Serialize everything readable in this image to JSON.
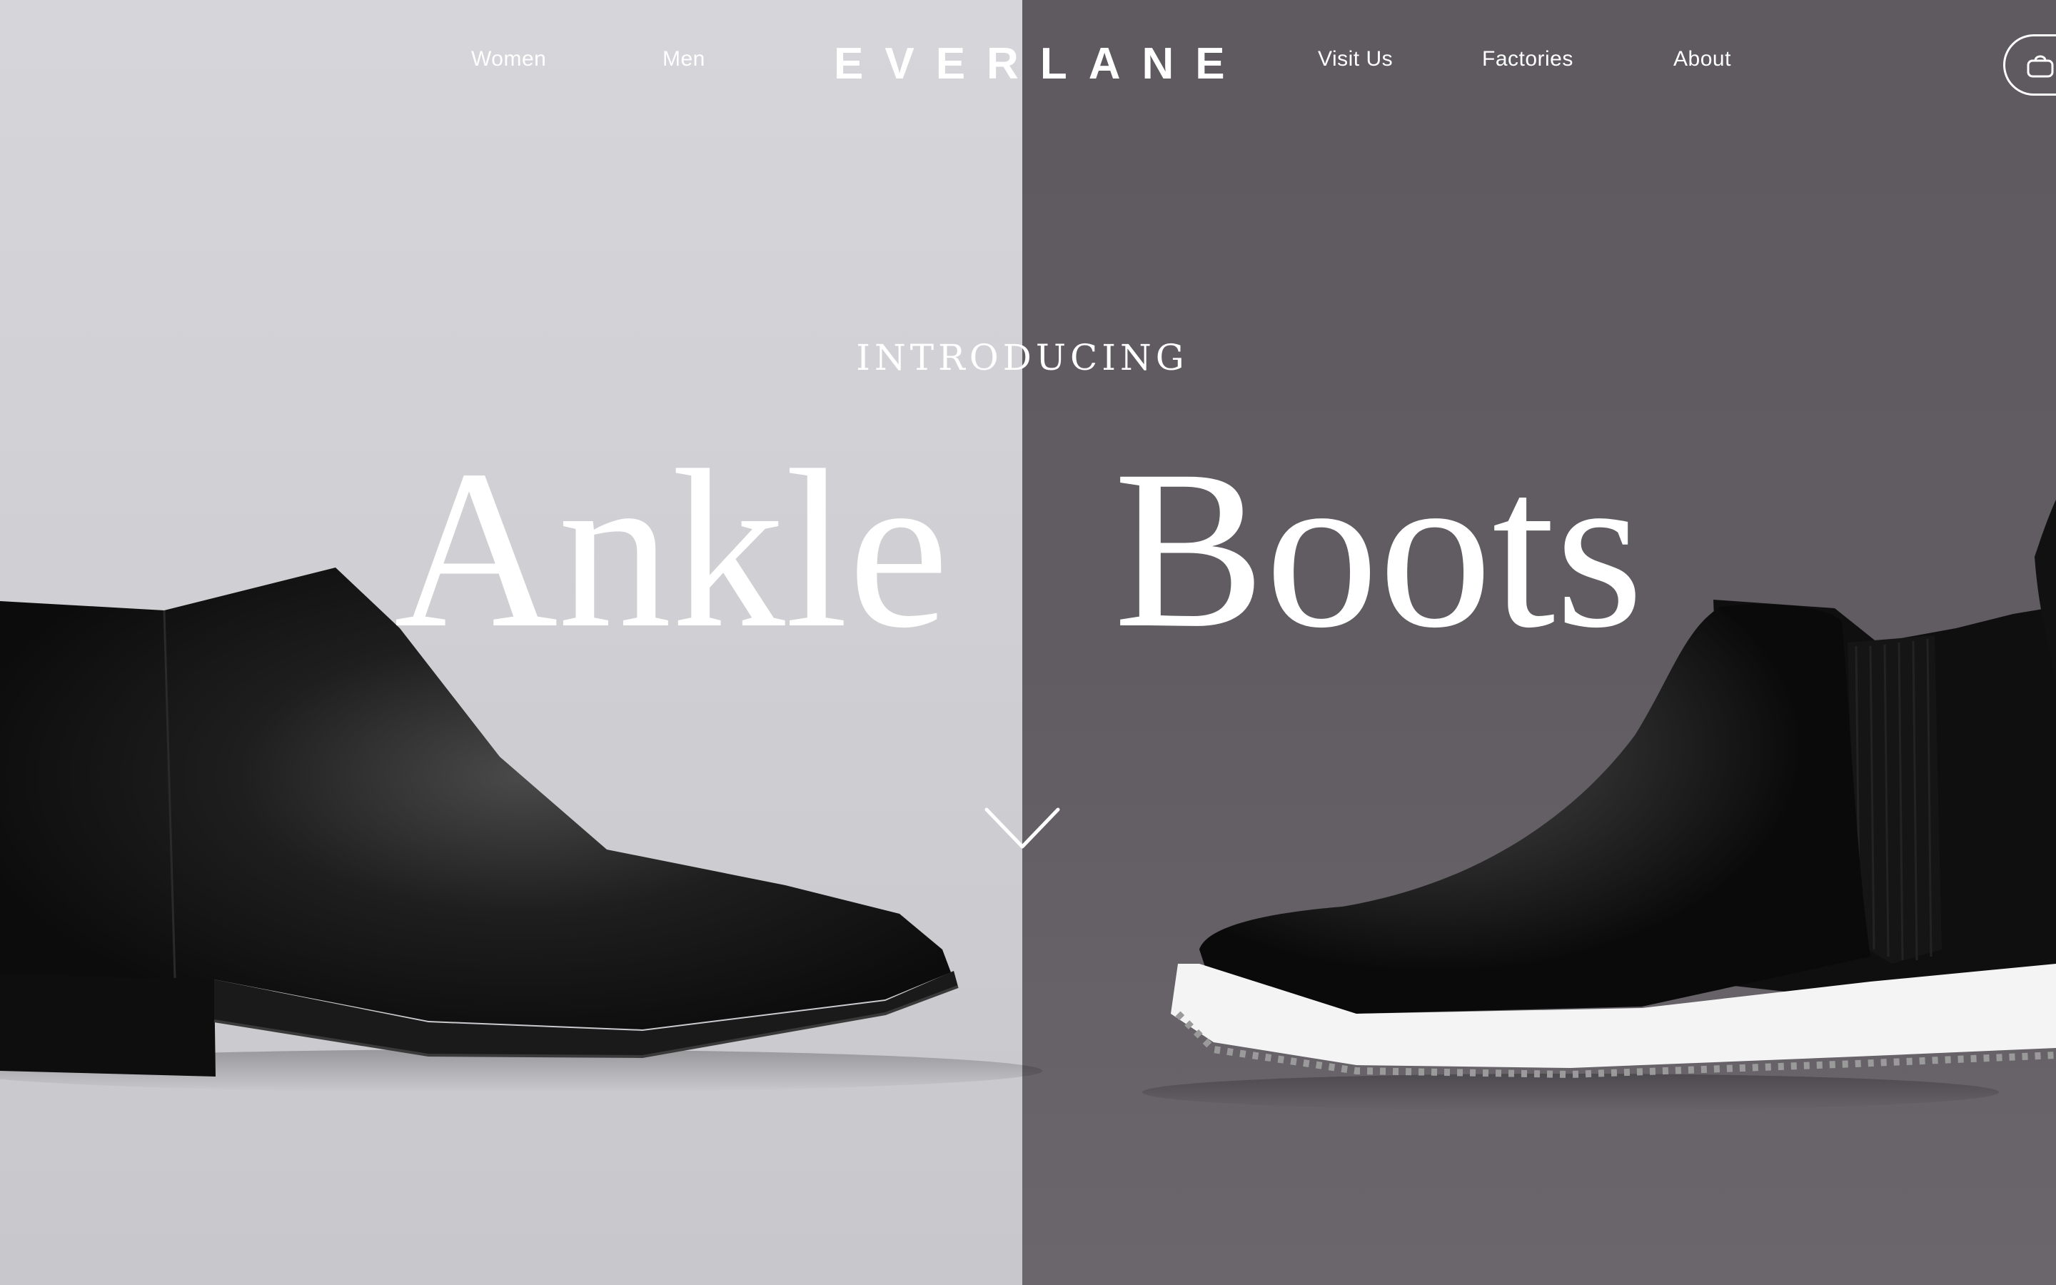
{
  "nav": {
    "left_links": [
      "Women",
      "Men"
    ],
    "logo": "EVERLANE",
    "right_links": [
      "Visit Us",
      "Factories",
      "About"
    ],
    "cart_icon": "cart-bag-icon"
  },
  "hero": {
    "kicker": "INTRODUCING",
    "headline_left": "Ankle",
    "headline_right": "Boots",
    "scroll_icon": "chevron-down-icon"
  },
  "colors": {
    "left_background": "#d2d2d6",
    "right_background": "#5f5b61",
    "text": "#ffffff",
    "boot": "#121212",
    "sole_right": "#f4f4f4"
  }
}
